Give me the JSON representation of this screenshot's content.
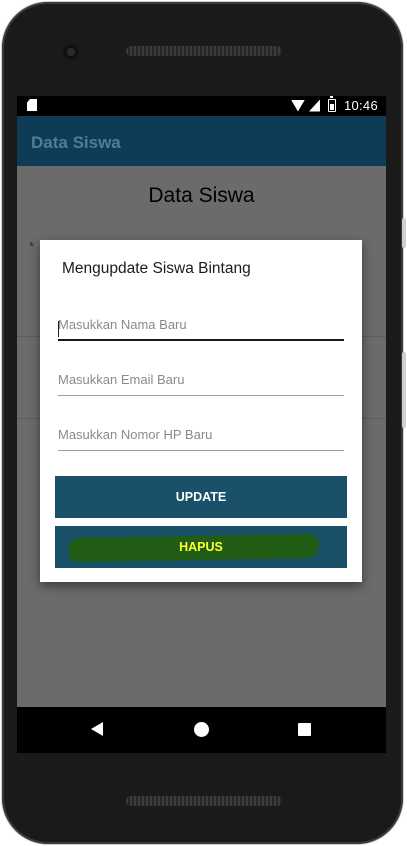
{
  "status_bar": {
    "time": "10:46",
    "icons": [
      "sd-card-icon",
      "wifi-icon",
      "signal-icon",
      "battery-icon"
    ]
  },
  "app_bar": {
    "title": "Data Siswa"
  },
  "page": {
    "heading": "Data Siswa",
    "asterisk": "*"
  },
  "dialog": {
    "title": "Mengupdate Siswa Bintang",
    "fields": {
      "name": {
        "value": "",
        "placeholder": "Masukkan Nama Baru"
      },
      "email": {
        "value": "",
        "placeholder": "Masukkan Email Baru"
      },
      "phone": {
        "value": "",
        "placeholder": "Masukkan Nomor HP Baru"
      }
    },
    "update_label": "UPDATE",
    "delete_label": "HAPUS"
  },
  "nav_bar": {
    "icons": [
      "back-icon",
      "home-icon",
      "recents-icon"
    ]
  },
  "colors": {
    "app_bar": "#0e3c57",
    "button": "#1a5068",
    "delete_text": "#ffff2b",
    "highlight": "#215d14"
  }
}
